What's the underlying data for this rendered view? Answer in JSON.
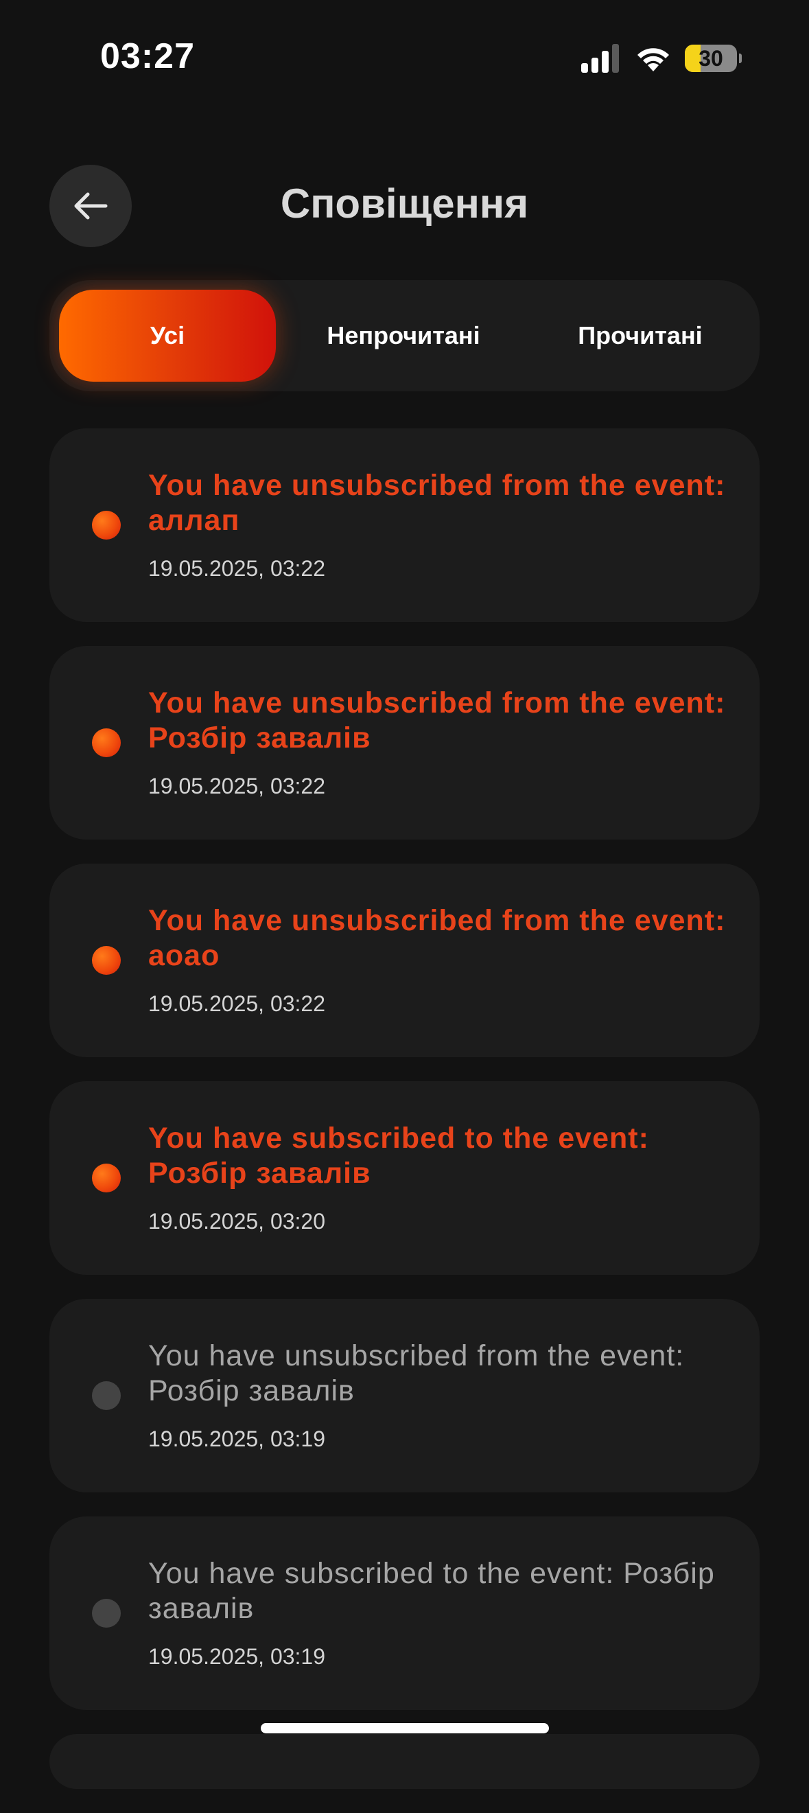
{
  "status_bar": {
    "time": "03:27",
    "battery_level": "30",
    "battery_fraction": 0.3,
    "icons": [
      "signal-icon",
      "wifi-icon",
      "battery-icon"
    ]
  },
  "header": {
    "title": "Сповіщення",
    "back_icon": "arrow-left-icon"
  },
  "tabs": [
    {
      "label": "Усі",
      "active": true
    },
    {
      "label": "Непрочитані",
      "active": false
    },
    {
      "label": "Прочитані",
      "active": false
    }
  ],
  "notifications": [
    {
      "text": "You have unsubscribed from the event: аллап",
      "time": "19.05.2025, 03:22",
      "unread": true
    },
    {
      "text": "You have unsubscribed from the event: Розбір завалів",
      "time": "19.05.2025, 03:22",
      "unread": true
    },
    {
      "text": "You have unsubscribed from the event: аоао",
      "time": "19.05.2025, 03:22",
      "unread": true
    },
    {
      "text": "You have subscribed to the event: Розбір завалів",
      "time": "19.05.2025, 03:20",
      "unread": true
    },
    {
      "text": "You have unsubscribed from the event: Розбір завалів",
      "time": "19.05.2025, 03:19",
      "unread": false
    },
    {
      "text": "You have subscribed to the event: Розбір завалів",
      "time": "19.05.2025, 03:19",
      "unread": false
    }
  ],
  "colors": {
    "background": "#121212",
    "card": "#1c1c1c",
    "accent_start": "#ff6a00",
    "accent_end": "#d1120a",
    "unread_text": "#e8431a",
    "read_text": "#a6a6a6",
    "battery": "#f5d31a"
  }
}
